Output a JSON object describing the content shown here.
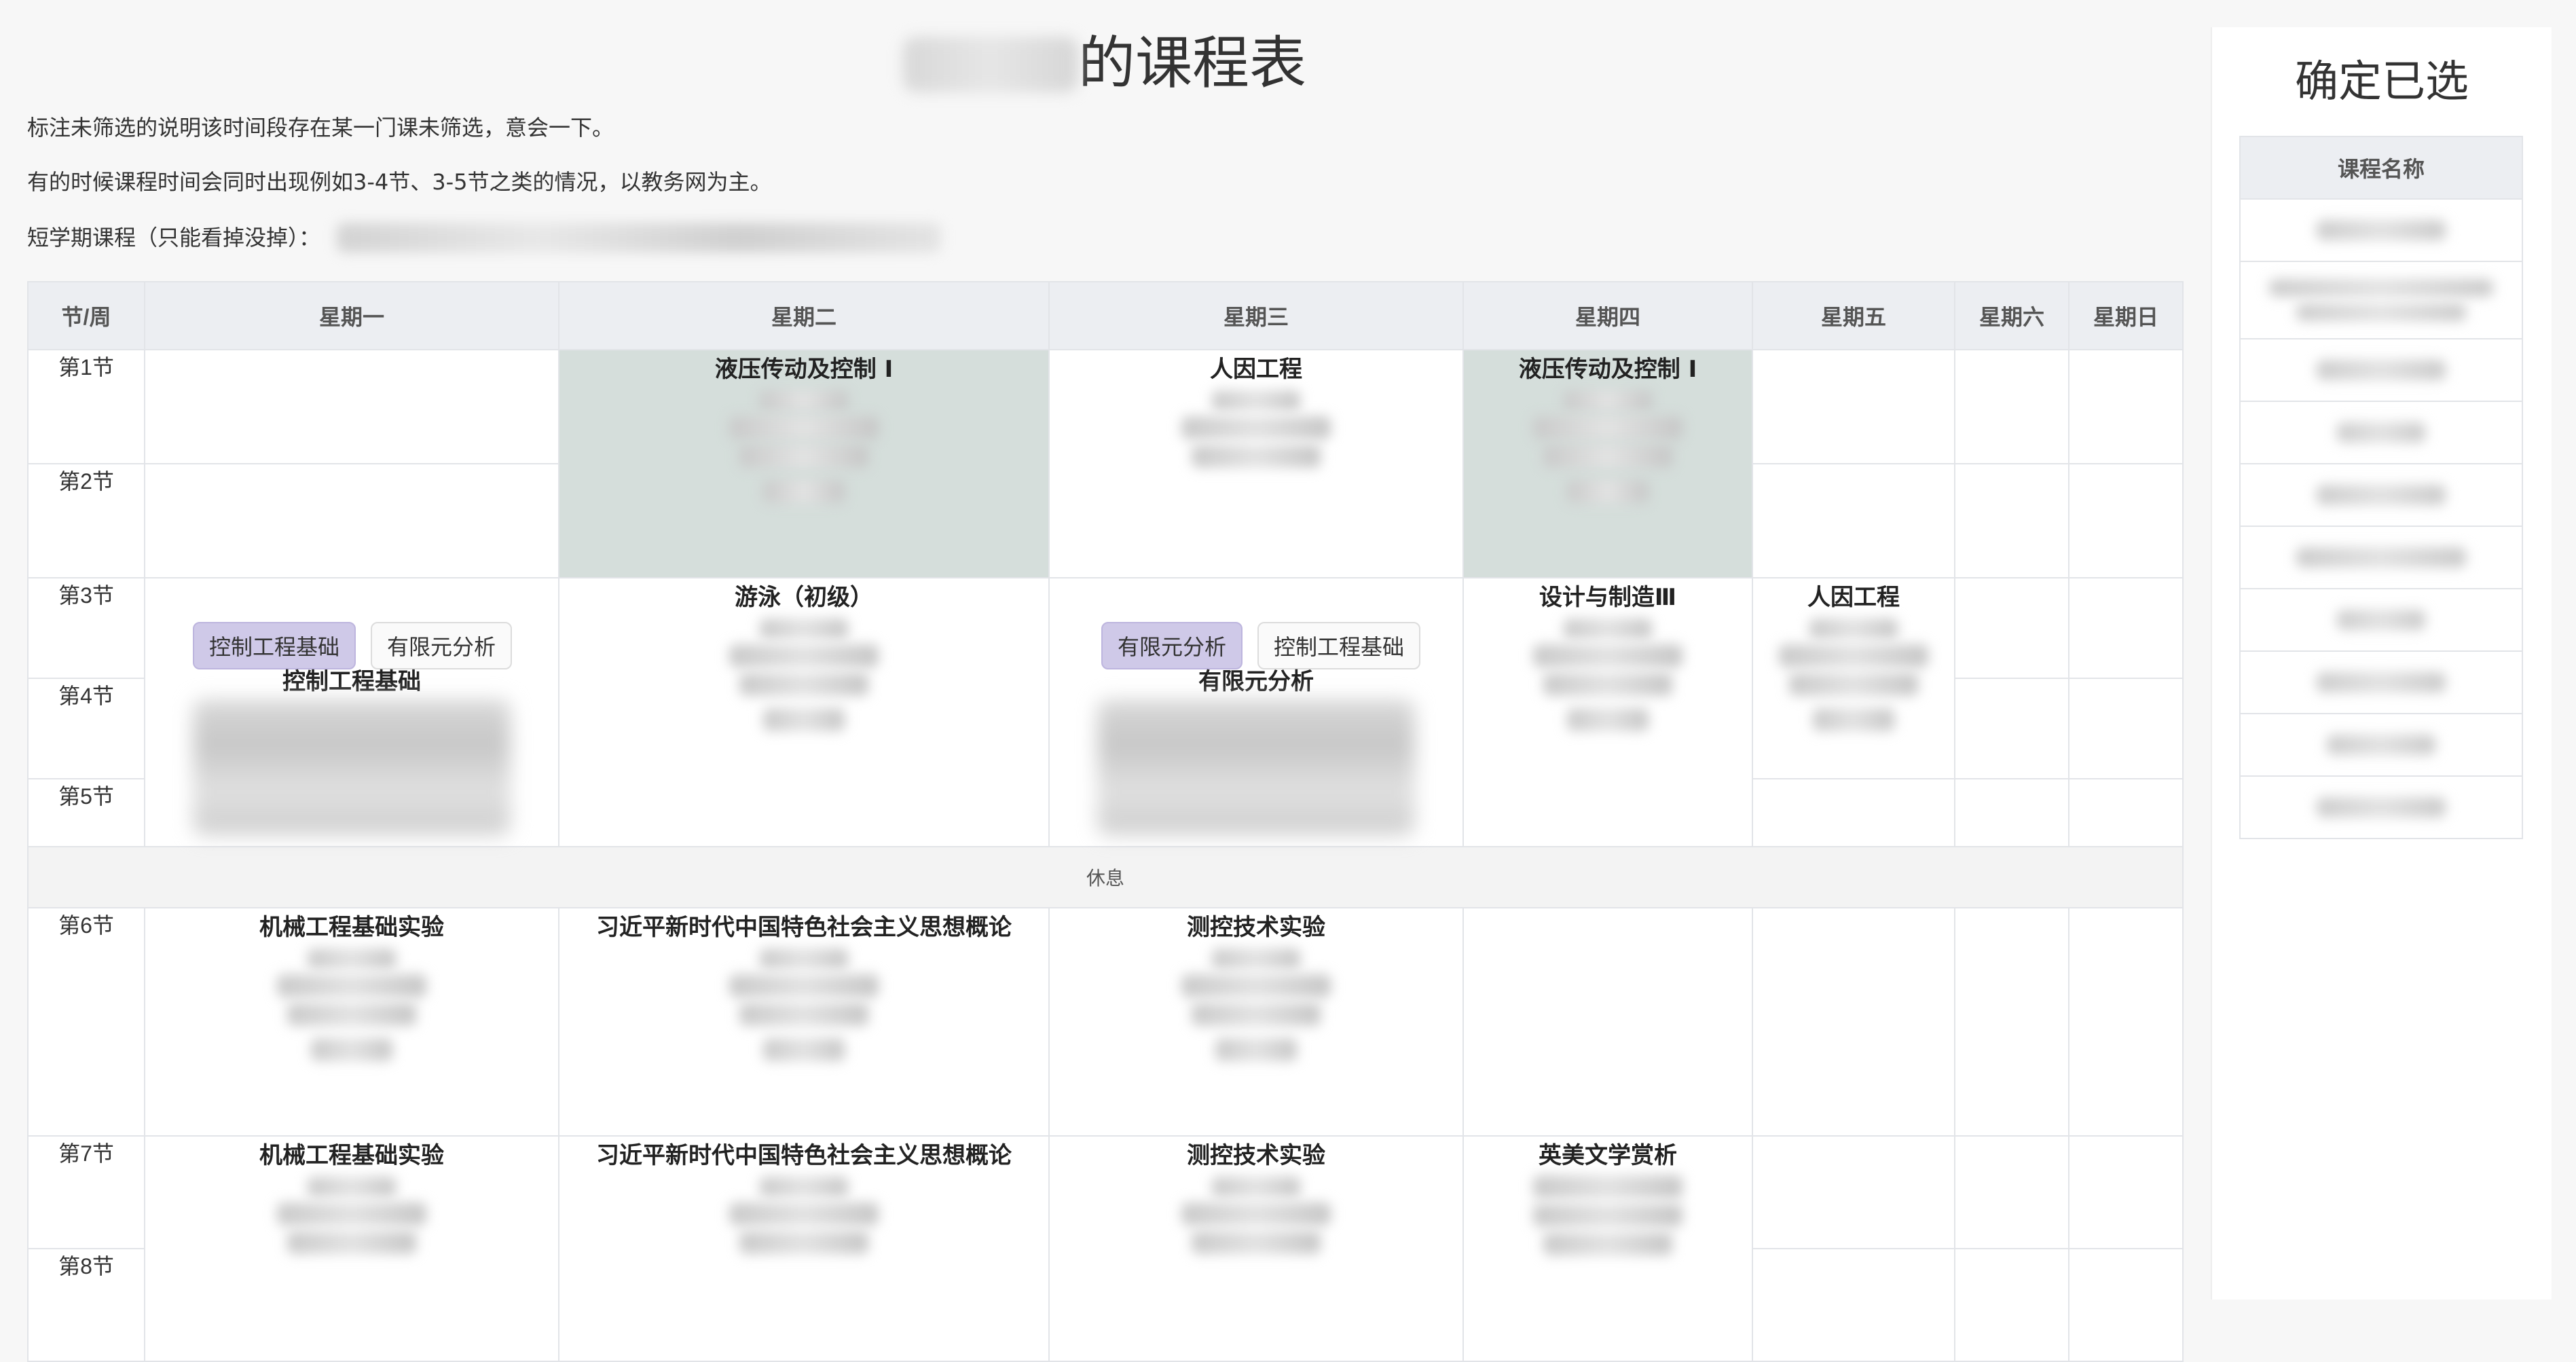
{
  "page": {
    "title_suffix": "的课程表",
    "note1": "标注未筛选的说明该时间段存在某一门课未筛选，意会一下。",
    "note2": "有的时候课程时间会同时出现例如3-4节、3-5节之类的情况，以教务网为主。",
    "short_term_label": "短学期课程（只能看掉没掉）："
  },
  "table": {
    "header": [
      "节/周",
      "星期一",
      "星期二",
      "星期三",
      "星期四",
      "星期五",
      "星期六",
      "星期日"
    ],
    "periods": [
      "第1节",
      "第2节",
      "第3节",
      "第4节",
      "第5节",
      "第6节",
      "第7节",
      "第8节"
    ],
    "break_label": "休息",
    "courses": {
      "tue_12": "液压传动及控制 I",
      "wed_12": "人因工程",
      "thu_12": "液压传动及控制 I",
      "tue_35": "游泳（初级）",
      "thu_34": "设计与制造Ⅲ",
      "fri_34": "人因工程",
      "mon_6": "机械工程基础实验",
      "tue_6": "习近平新时代中国特色社会主义思想概论",
      "wed_6": "测控技术实验",
      "mon_78": "机械工程基础实验",
      "tue_78": "习近平新时代中国特色社会主义思想概论",
      "wed_78": "测控技术实验",
      "thu_78": "英美文学赏析"
    },
    "conflict_mon": {
      "tabs": [
        "控制工程基础",
        "有限元分析"
      ],
      "active": "控制工程基础",
      "shown": "控制工程基础"
    },
    "conflict_wed": {
      "tabs": [
        "有限元分析",
        "控制工程基础"
      ],
      "active": "有限元分析",
      "shown": "有限元分析"
    }
  },
  "sidebar": {
    "title": "确定已选",
    "column_header": "课程名称"
  },
  "colors": {
    "highlight_cell": "#d5dedb",
    "active_tab": "#cfc9e8",
    "header_bg": "#eceef2"
  }
}
